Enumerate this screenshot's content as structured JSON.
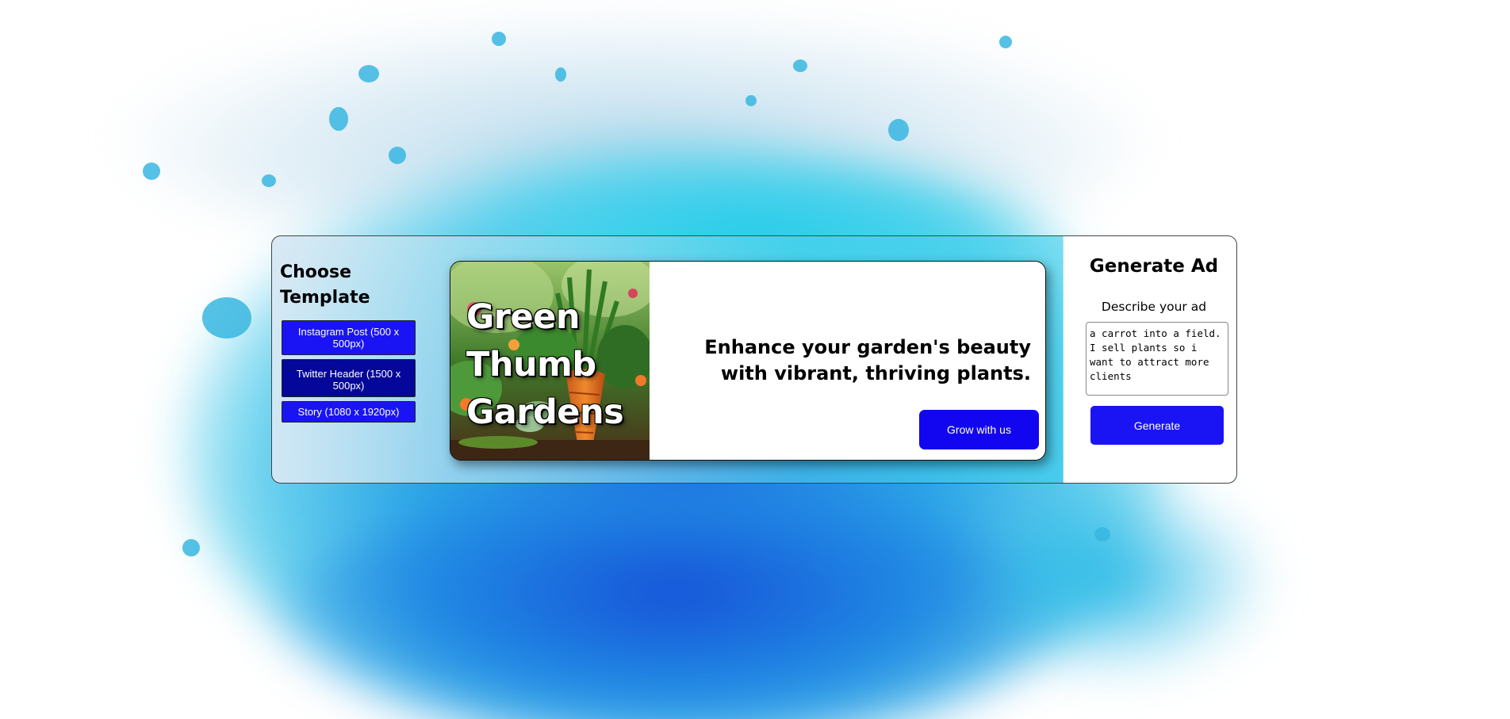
{
  "left": {
    "title": "Choose Template",
    "templates": [
      {
        "label": "Instagram Post (500 x 500px)"
      },
      {
        "label": "Twitter Header (1500 x 500px)"
      },
      {
        "label": "Story (1080 x 1920px)"
      }
    ]
  },
  "ad": {
    "brand": "Green Thumb Gardens",
    "headline": "Enhance your garden's beauty with vibrant, thriving plants.",
    "cta": "Grow with us"
  },
  "right": {
    "title": "Generate Ad",
    "description_label": "Describe your ad",
    "description_value": "a carrot into a field. I sell plants so i want to attract more clients",
    "generate_label": "Generate"
  },
  "colors": {
    "primary_button": "#1a14f5",
    "selected_template": "#05079a",
    "cta": "#1206f0"
  }
}
